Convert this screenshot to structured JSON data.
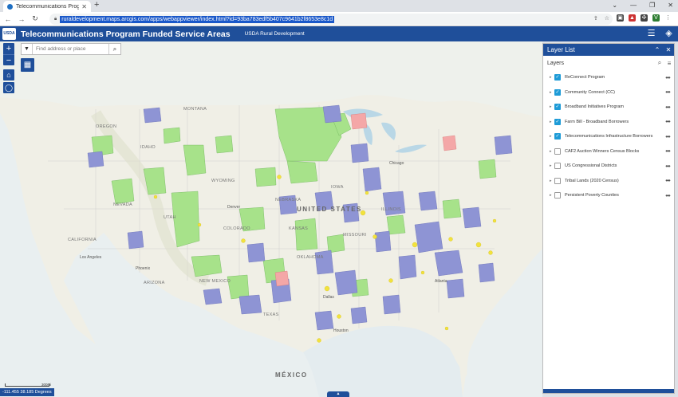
{
  "browser": {
    "tab_title": "Telecommunications Program Fu",
    "url": "ruraldevelopment.maps.arcgis.com/apps/webappviewer/index.html?id=93ba783edf5b407c9641b2f8653e8c1d"
  },
  "header": {
    "title": "Telecommunications Program Funded Service Areas",
    "subtitle": "USDA Rural Development",
    "logo_text": "USDA"
  },
  "search": {
    "placeholder": "Find address or place"
  },
  "coordinates": "-111.455 38.185 Degrees",
  "scale": "300mi",
  "map_labels": {
    "oregon": "OREGON",
    "idaho": "IDAHO",
    "wyoming": "WYOMING",
    "nevada": "NEVADA",
    "utah": "UTAH",
    "colorado": "COLORADO",
    "california": "CALIFORNIA",
    "arizona": "ARIZONA",
    "new_mexico": "NEW MEXICO",
    "texas": "TEXAS",
    "oklahoma": "OKLAHOMA",
    "kansas": "KANSAS",
    "nebraska": "NEBRASKA",
    "iowa": "IOWA",
    "illinois": "ILLINOIS",
    "missouri": "MISSOURI",
    "montana": "MONTANA",
    "united_states": "UNITED STATES",
    "mexico": "MÉXICO",
    "houston": "Houston",
    "dallas": "Dallas",
    "denver": "Denver",
    "chicago": "Chicago",
    "atlanta": "Atlanta",
    "phoenix": "Phoenix",
    "los_angeles": "Los Angeles"
  },
  "layer_list": {
    "title": "Layer List",
    "section": "Layers",
    "layers": [
      {
        "name": "ReConnect Program",
        "checked": true
      },
      {
        "name": "Community Connect (CC)",
        "checked": true
      },
      {
        "name": "Broadband Initiatives Program",
        "checked": true
      },
      {
        "name": "Farm Bill - Broadband Borrowers",
        "checked": true
      },
      {
        "name": "Telecommunications Infrastructure Borrowers",
        "checked": true
      },
      {
        "name": "CAF2 Auction Winners Census Blocks",
        "checked": false
      },
      {
        "name": "US Congressional Districts",
        "checked": false
      },
      {
        "name": "Tribal Lands (2020 Census)",
        "checked": false
      },
      {
        "name": "Persistent Poverty Counties",
        "checked": false
      }
    ]
  },
  "colors": {
    "header": "#1f4f9a",
    "reconnect": "#a7e28a",
    "telecom": "#8e94d4",
    "community": "#f4a7a7",
    "farm_bill": "#f2e23c",
    "checkbox": "#1e9bd7"
  }
}
